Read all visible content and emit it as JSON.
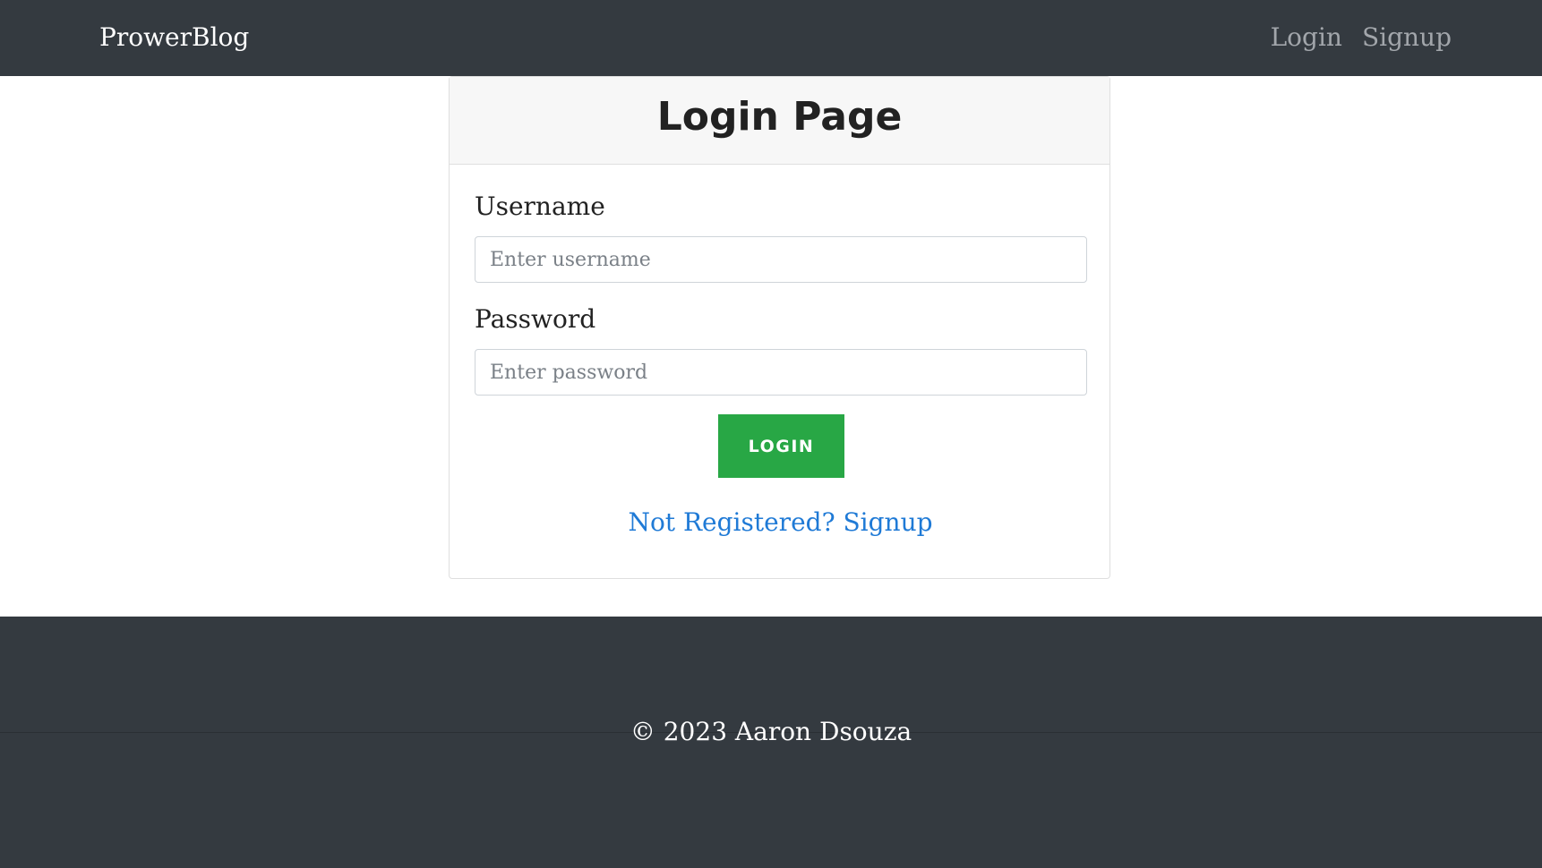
{
  "navbar": {
    "brand": "ProwerBlog",
    "links": [
      {
        "label": "Login"
      },
      {
        "label": "Signup"
      }
    ]
  },
  "login_card": {
    "title": "Login Page",
    "username": {
      "label": "Username",
      "placeholder": "Enter username",
      "value": ""
    },
    "password": {
      "label": "Password",
      "placeholder": "Enter password",
      "value": ""
    },
    "submit_label": "LOGIN",
    "signup_prompt": "Not Registered? Signup"
  },
  "footer": {
    "copyright": "© 2023 Aaron Dsouza"
  },
  "colors": {
    "navbar_bg": "#343a40",
    "button_green": "#28a745",
    "link_blue": "#1f7ad6"
  }
}
